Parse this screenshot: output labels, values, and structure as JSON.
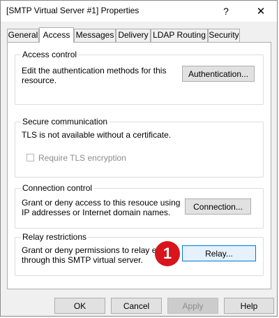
{
  "window": {
    "title": "[SMTP Virtual Server #1] Properties",
    "help_glyph": "?",
    "close_glyph": "✕"
  },
  "tabs": [
    {
      "label": "General",
      "active": false
    },
    {
      "label": "Access",
      "active": true
    },
    {
      "label": "Messages",
      "active": false
    },
    {
      "label": "Delivery",
      "active": false
    },
    {
      "label": "LDAP Routing",
      "active": false
    },
    {
      "label": "Security",
      "active": false
    }
  ],
  "groups": {
    "access_control": {
      "title": "Access control",
      "description": "Edit the authentication methods for this\nresource.",
      "button": "Authentication..."
    },
    "secure_communication": {
      "title": "Secure communication",
      "description": "TLS is not available without a certificate.",
      "checkbox_label": "Require TLS encryption",
      "checkbox_checked": false
    },
    "connection_control": {
      "title": "Connection control",
      "description": "Grant or deny access to this resouce using\nIP addresses or Internet domain names.",
      "button": "Connection..."
    },
    "relay_restrictions": {
      "title": "Relay restrictions",
      "description": "Grant or deny permissions to relay e-mail\nthrough this SMTP virtual server.",
      "button": "Relay..."
    }
  },
  "annotation": {
    "label": "1",
    "color": "#d8151c"
  },
  "footer": {
    "ok": "OK",
    "cancel": "Cancel",
    "apply": "Apply",
    "help": "Help"
  }
}
